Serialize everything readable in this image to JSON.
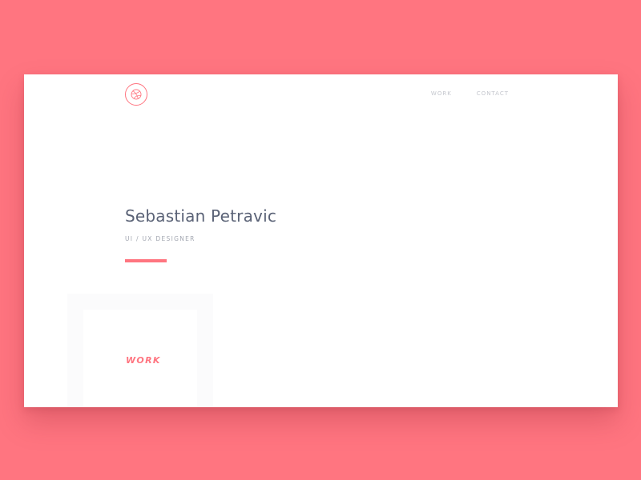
{
  "brand": {
    "logo_icon": "dribbble-ball-icon",
    "accent_color": "#ff7580"
  },
  "nav": {
    "items": [
      {
        "label": "WORK"
      },
      {
        "label": "CONTACT"
      }
    ]
  },
  "hero": {
    "name": "Sebastian Petravic",
    "role": "UI / UX DESIGNER"
  },
  "sections": {
    "work_title": "WORK"
  },
  "colors": {
    "background": "#ff7580",
    "card": "#ffffff",
    "heading_text": "#5a6276",
    "muted_text": "#a4a8b2",
    "nav_text": "#c4c6cd"
  }
}
